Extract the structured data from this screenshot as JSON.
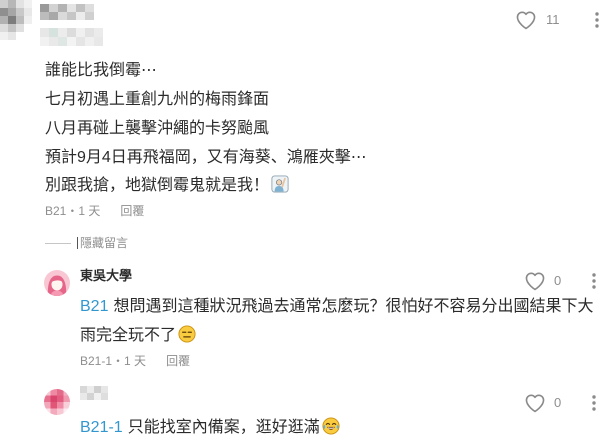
{
  "theme": {
    "text": "#2b2b2b",
    "secondary": "#8e8e8e",
    "mention": "#3397cf",
    "icon": "#8a8a8a"
  },
  "icons": {
    "like": "heart-outline-icon",
    "more": "more-vertical-icon"
  },
  "meta_separator": "・",
  "post_comment": {
    "avatar": "pixelated-avatar",
    "likes": "11",
    "lines": [
      "誰能比我倒霉⋯",
      "七月初遇上重創九州的梅雨鋒面",
      "八月再碰上襲擊沖繩的卡努颱風",
      "預計9月4日再飛福岡，又有海葵、鴻雁夾擊⋯",
      "別跟我搶，地獄倒霉鬼就是我！"
    ],
    "trailing_emoji": "raising-hand-emoji",
    "floor": "B21",
    "time": "1 天",
    "reply_label": "回覆"
  },
  "hide_replies_label": "隱藏留言",
  "replies": [
    {
      "avatar": "female-default-avatar",
      "author": "東吳大學",
      "likes": "0",
      "mention": "B21",
      "lines": [
        "想問遇到這種狀況飛過去通常怎麼玩？很怕好不容易分出國結果下大",
        "雨完全玩不了"
      ],
      "trailing_emoji": "expressionless-face-emoji",
      "floor": "B21-1",
      "time": "1 天",
      "reply_label": "回覆"
    },
    {
      "avatar": "pixelated-avatar",
      "likes": "0",
      "mention": "B21-1",
      "lines": [
        "只能找室內備案，逛好逛滿"
      ],
      "trailing_emoji": "face-with-tears-of-joy-emoji"
    }
  ]
}
